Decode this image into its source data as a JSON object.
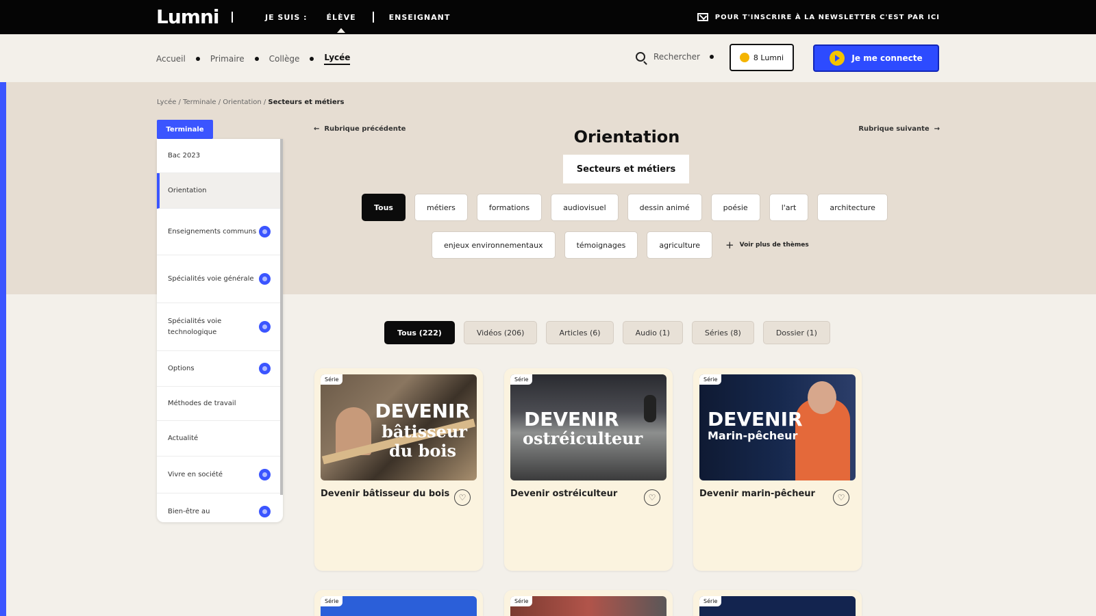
{
  "topbar": {
    "logo": "Lumni",
    "nav": [
      "JE SUIS :",
      "ÉLÈVE",
      "ENSEIGNANT"
    ],
    "newsletter": "POUR T'INSCRIRE À LA NEWSLETTER C'EST PAR ICI"
  },
  "subnav": {
    "levels": [
      "Accueil",
      "Primaire",
      "Collège",
      "Lycée"
    ],
    "search_label": "Rechercher",
    "mylumni": "8 Lumni",
    "connect": "Je me connecte"
  },
  "breadcrumb": {
    "path": "Lycée / Terminale / Orientation / ",
    "current": "Secteurs et métiers"
  },
  "sidebar": {
    "header": "Terminale",
    "items": [
      {
        "label": "Bac 2023",
        "badge": false
      },
      {
        "label": "Orientation",
        "badge": false
      },
      {
        "label": "Enseignements communs",
        "badge": true
      },
      {
        "label": "Spécialités voie générale",
        "badge": true
      },
      {
        "label": "Spécialités voie technologique",
        "badge": true
      },
      {
        "label": "Options",
        "badge": true
      },
      {
        "label": "Méthodes de travail",
        "badge": false
      },
      {
        "label": "Actualité",
        "badge": false
      },
      {
        "label": "Vivre en société",
        "badge": true
      },
      {
        "label": "Bien-être au",
        "badge": true
      }
    ]
  },
  "header": {
    "prev": "Rubrique précédente",
    "next": "Rubrique suivante",
    "title": "Orientation",
    "subtitle": "Secteurs et métiers"
  },
  "tags_row1": [
    "Tous",
    "métiers",
    "formations",
    "audiovisuel",
    "dessin animé",
    "poésie",
    "l'art",
    "architecture"
  ],
  "tags_row2": [
    "enjeux environnementaux",
    "témoignages",
    "agriculture"
  ],
  "more_themes": "Voir plus de thèmes",
  "content_types": [
    "Tous (222)",
    "Vidéos (206)",
    "Articles (6)",
    "Audio (1)",
    "Séries (8)",
    "Dossier (1)"
  ],
  "cards": [
    {
      "badge": "Série",
      "title": "Devenir bâtisseur du bois",
      "thumb_line1": "DEVENIR",
      "thumb_line2": "bâtisseur",
      "thumb_line3": "du bois"
    },
    {
      "badge": "Série",
      "title": "Devenir ostréiculteur",
      "thumb_line1": "DEVENIR",
      "thumb_line2": "ostréiculteur",
      "thumb_line3": ""
    },
    {
      "badge": "Série",
      "title": "Devenir marin-pêcheur",
      "thumb_line1": "DEVENIR",
      "thumb_line2": "Marin-pêcheur",
      "thumb_line3": ""
    }
  ],
  "cards_row2": [
    {
      "badge": "Série"
    },
    {
      "badge": "Série"
    },
    {
      "badge": "Série"
    }
  ],
  "colors": {
    "accent": "#3b55ff",
    "dark": "#050505",
    "hero": "#e6ddd2",
    "card": "#fbf3df"
  }
}
